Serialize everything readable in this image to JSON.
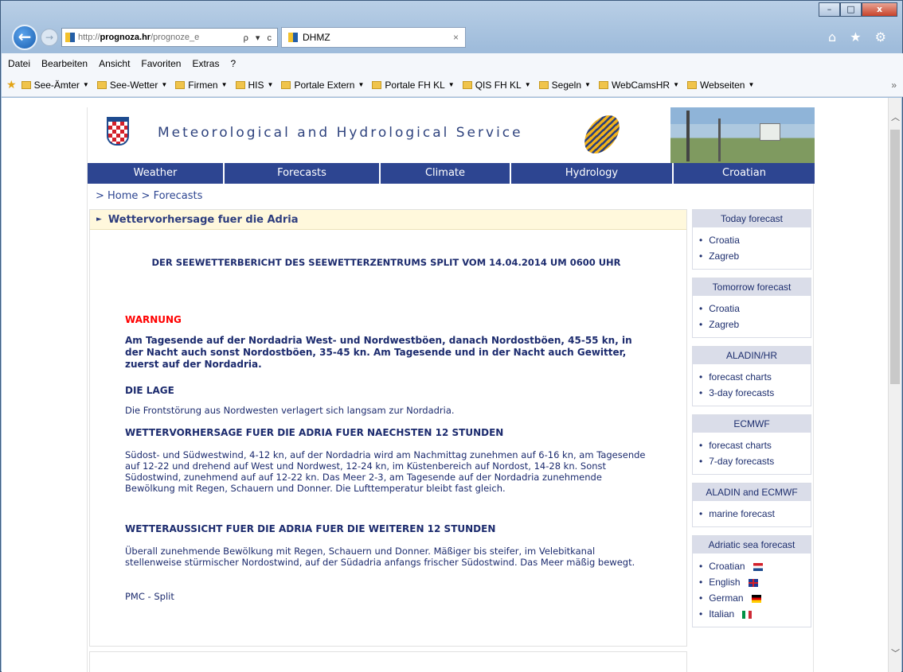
{
  "browser": {
    "address_prefix": "http://",
    "address_host": "prognoza.hr",
    "address_path": "/prognoze_e",
    "address_tools": "ρ ▾ c",
    "tab_title": "DHMZ",
    "tab_close": "×",
    "window_buttons": [
      "–",
      "□",
      "x"
    ],
    "right_tools": "⌂ ★ ⚙",
    "back_glyph": "←",
    "forward_glyph": "→"
  },
  "menubar": {
    "items": [
      "Datei",
      "Bearbeiten",
      "Ansicht",
      "Favoriten",
      "Extras",
      "?"
    ]
  },
  "favorites": {
    "items": [
      "See-Ämter",
      "See-Wetter",
      "Firmen",
      "HIS",
      "Portale Extern",
      "Portale FH KL",
      "QIS FH KL",
      "Segeln",
      "WebCamsHR",
      "Webseiten"
    ],
    "more": "»"
  },
  "site": {
    "title": "Meteorological and Hydrological Service",
    "nav": [
      "Weather",
      "Forecasts",
      "Climate",
      "Hydrology",
      "Croatian"
    ],
    "breadcrumb": "> Home > Forecasts"
  },
  "main": {
    "heading": "Wettervorhersage fuer die Adria",
    "title": "DER SEEWETTERBERICHT DES SEEWETTERZENTRUMS SPLIT VOM 14.04.2014 UM 0600 UHR",
    "warning_label": "WARNUNG",
    "warning_text": "Am Tagesende auf der Nordadria West- und Nordwestböen, danach Nordostböen, 45-55 kn, in der Nacht auch sonst Nordostböen, 35-45 kn. Am Tagesende und in der Nacht auch Gewitter, zuerst auf der Nordadria.",
    "lage_heading": "DIE LAGE",
    "lage_text": "Die Frontstörung aus Nordwesten verlagert sich langsam zur Nordadria.",
    "forecast_heading": "WETTERVORHERSAGE FUER DIE ADRIA FUER NAECHSTEN 12 STUNDEN",
    "forecast_text": "Südost- und Südwestwind, 4-12 kn, auf der Nordadria wird am Nachmittag zunehmen auf 6-16 kn, am Tagesende auf 12-22 und drehend auf West und Nordwest, 12-24 kn, im Küstenbereich auf Nordost, 14-28 kn. Sonst Südostwind, zunehmend auf auf 12-22 kn. Das Meer 2-3, am Tagesende auf der Nordadria zunehmende Bewölkung mit Regen, Schauern und Donner. Die Lufttemperatur bleibt fast gleich.",
    "outlook_heading": "WETTERAUSSICHT FUER DIE ADRIA FUER DIE WEITEREN 12 STUNDEN",
    "outlook_text": "Überall zunehmende Bewölkung mit Regen, Schauern und Donner. Mäßiger bis steifer, im Velebitkanal stellenweise stürmischer Nordostwind, auf der Südadria anfangs frischer Südostwind. Das Meer mäßig bewegt.",
    "signature": "PMC - Split"
  },
  "sidebar": {
    "boxes": [
      {
        "title": "Today forecast",
        "items": [
          "Croatia",
          "Zagreb"
        ]
      },
      {
        "title": "Tomorrow forecast",
        "items": [
          "Croatia",
          "Zagreb"
        ]
      },
      {
        "title": "ALADIN/HR",
        "items": [
          "forecast charts",
          "3-day forecasts"
        ]
      },
      {
        "title": "ECMWF",
        "items": [
          "forecast charts",
          "7-day forecasts"
        ]
      },
      {
        "title": "ALADIN and ECMWF",
        "items": [
          "marine forecast"
        ]
      },
      {
        "title": "Adriatic sea forecast",
        "items": [
          "Croatian",
          "English",
          "German",
          "Italian"
        ]
      }
    ]
  }
}
